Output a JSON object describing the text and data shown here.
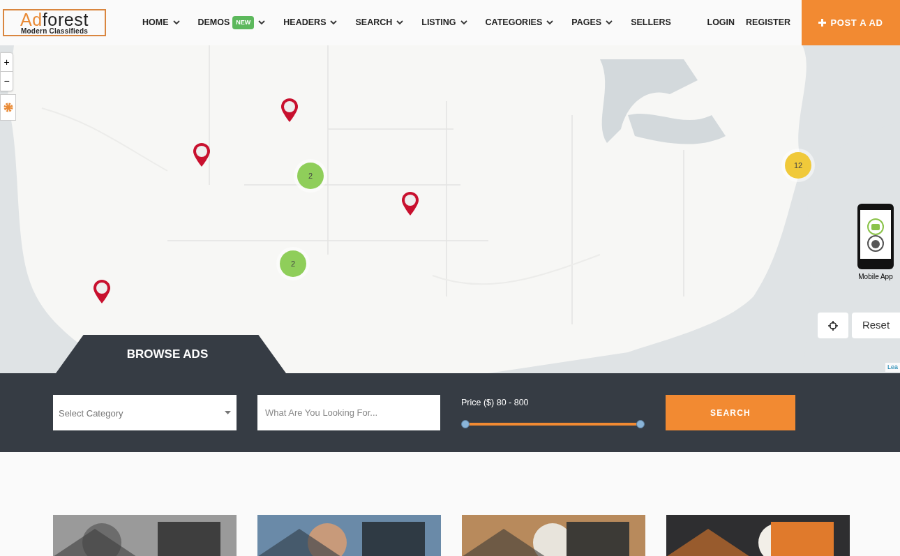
{
  "logo": {
    "first": "Ad",
    "second": "forest",
    "tagline": "Modern Classifieds"
  },
  "nav": [
    {
      "label": "HOME",
      "dropdown": true
    },
    {
      "label": "DEMOS",
      "badge": "NEW",
      "dropdown": true
    },
    {
      "label": "HEADERS",
      "dropdown": true
    },
    {
      "label": "SEARCH",
      "dropdown": true
    },
    {
      "label": "LISTING",
      "dropdown": true
    },
    {
      "label": "CATEGORIES",
      "dropdown": true
    },
    {
      "label": "PAGES",
      "dropdown": true
    },
    {
      "label": "SELLERS",
      "dropdown": false
    }
  ],
  "auth": [
    "LOGIN",
    "REGISTER"
  ],
  "post_button": "POST A AD",
  "map": {
    "zoom_in": "+",
    "zoom_out": "−",
    "clusters": [
      {
        "count": "2",
        "color": "#8fce5a"
      },
      {
        "count": "2",
        "color": "#8fce5a"
      },
      {
        "count": "12",
        "color": "#f0c93a"
      }
    ],
    "mobile_app_label": "Mobile App",
    "reset": "Reset",
    "attribution": "Lea"
  },
  "search": {
    "tab": "BROWSE ADS",
    "category_placeholder": "Select Category",
    "keyword_placeholder": "What Are You Looking For...",
    "price_label": "Price ($) 80 - 800",
    "range": {
      "low": {
        "level": 0
      },
      "high": {
        "level": 1
      }
    },
    "button": "SEARCH"
  },
  "cards": [
    {
      "kind": "picture"
    },
    {
      "kind": "picture"
    },
    {
      "kind": "picture"
    },
    {
      "kind": "picture"
    }
  ]
}
